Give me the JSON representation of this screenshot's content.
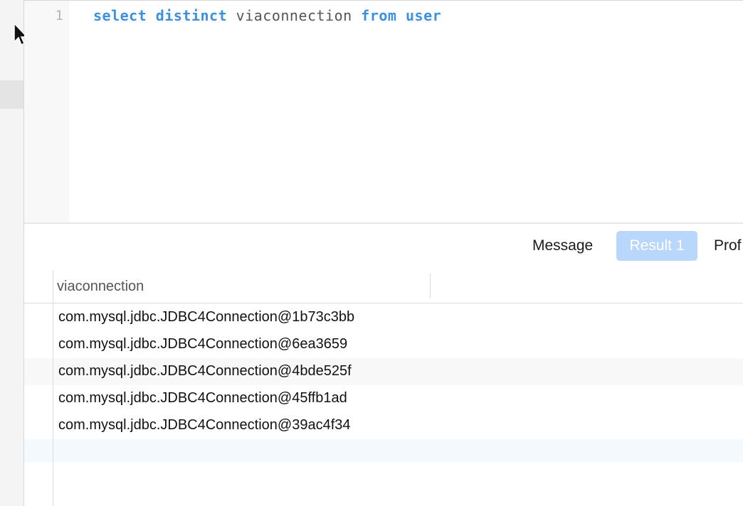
{
  "editor": {
    "line_number": "1",
    "tokens": {
      "select": "select",
      "distinct": "distinct",
      "column": "viaconnection",
      "from": "from",
      "table": "user"
    }
  },
  "tabs": {
    "message": "Message",
    "result": "Result 1",
    "profile": "Prof"
  },
  "grid": {
    "columns": [
      "viaconnection"
    ],
    "rows": [
      "com.mysql.jdbc.JDBC4Connection@1b73c3bb",
      "com.mysql.jdbc.JDBC4Connection@6ea3659",
      "com.mysql.jdbc.JDBC4Connection@4bde525f",
      "com.mysql.jdbc.JDBC4Connection@45ffb1ad",
      "com.mysql.jdbc.JDBC4Connection@39ac4f34"
    ]
  },
  "colors": {
    "keyword": "#3d8fe0",
    "active_tab": "#b9d6fb"
  },
  "icons": {
    "cursor": "mouse-pointer-icon"
  }
}
